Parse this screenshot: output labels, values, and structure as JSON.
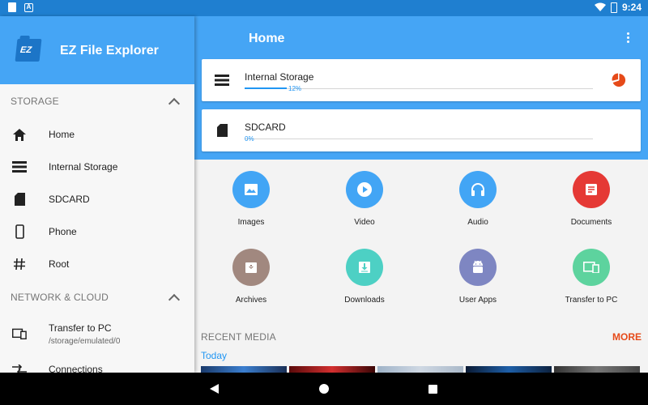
{
  "status": {
    "time": "9:24",
    "battery_text": ""
  },
  "drawer": {
    "app_title": "EZ File Explorer",
    "logo_text": "EZ",
    "storage_header": "STORAGE",
    "storage_items": [
      {
        "label": "Home",
        "icon": "home-icon"
      },
      {
        "label": "Internal Storage",
        "icon": "storage-icon"
      },
      {
        "label": "SDCARD",
        "icon": "sdcard-icon"
      },
      {
        "label": "Phone",
        "icon": "phone-icon"
      },
      {
        "label": "Root",
        "icon": "hash-icon"
      }
    ],
    "network_header": "NETWORK & CLOUD",
    "network_items": [
      {
        "label": "Transfer to PC",
        "sub": "/storage/emulated/0",
        "icon": "devices-icon"
      },
      {
        "label": "Connections",
        "icon": "connections-icon"
      }
    ]
  },
  "main": {
    "title": "Home",
    "cards": [
      {
        "title": "Internal Storage",
        "percent_label": "12%",
        "percent": 12
      },
      {
        "title": "SDCARD",
        "percent_label": "0%",
        "percent": 0
      }
    ],
    "categories": [
      {
        "label": "Images",
        "color": "#42a5f5",
        "icon": "image-icon"
      },
      {
        "label": "Video",
        "color": "#42a5f5",
        "icon": "play-icon"
      },
      {
        "label": "Audio",
        "color": "#42a5f5",
        "icon": "headphones-icon"
      },
      {
        "label": "Documents",
        "color": "#e53935",
        "icon": "document-icon"
      },
      {
        "label": "Archives",
        "color": "#a1887f",
        "icon": "archive-icon"
      },
      {
        "label": "Downloads",
        "color": "#4dd0c4",
        "icon": "download-icon"
      },
      {
        "label": "User Apps",
        "color": "#7e86c2",
        "icon": "android-icon"
      },
      {
        "label": "Transfer to PC",
        "color": "#5dd39e",
        "icon": "devices-icon"
      }
    ],
    "recent_header": "RECENT MEDIA",
    "more_label": "MORE",
    "today_label": "Today"
  },
  "colors": {
    "primary": "#45a5f5",
    "status_bar": "#1f7fd0",
    "accent_more": "#e64a19"
  }
}
